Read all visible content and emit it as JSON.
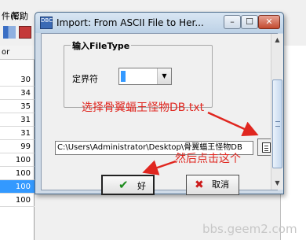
{
  "background": {
    "menu": [
      "件(E)",
      "帮助"
    ],
    "grid_header": "or",
    "grid_values": [
      "30",
      "34",
      "35",
      "31",
      "31",
      "99",
      "100",
      "100",
      "100",
      "100",
      "100"
    ],
    "selected_row_index": 9
  },
  "dialog": {
    "title": "Import: From ASCII File to Her...",
    "title_icon_text": "DBC",
    "window_buttons": {
      "minimize": "–",
      "maximize": "☐",
      "close": "✕"
    },
    "group_label": "输入FileType",
    "delimiter_label": "定界符",
    "delimiter_value": "",
    "file_path": "C:\\Users\\Administrator\\Desktop\\骨翼蝠王怪物DB",
    "ok_label": "好",
    "cancel_label": "取消"
  },
  "annotations": {
    "select_file": "选择骨翼蝠王怪物DB.txt",
    "then_click": "然后点击这个"
  },
  "watermark": "bbs.geem2.com",
  "colors": {
    "annotation": "#e0261f",
    "selection": "#3399ff"
  }
}
